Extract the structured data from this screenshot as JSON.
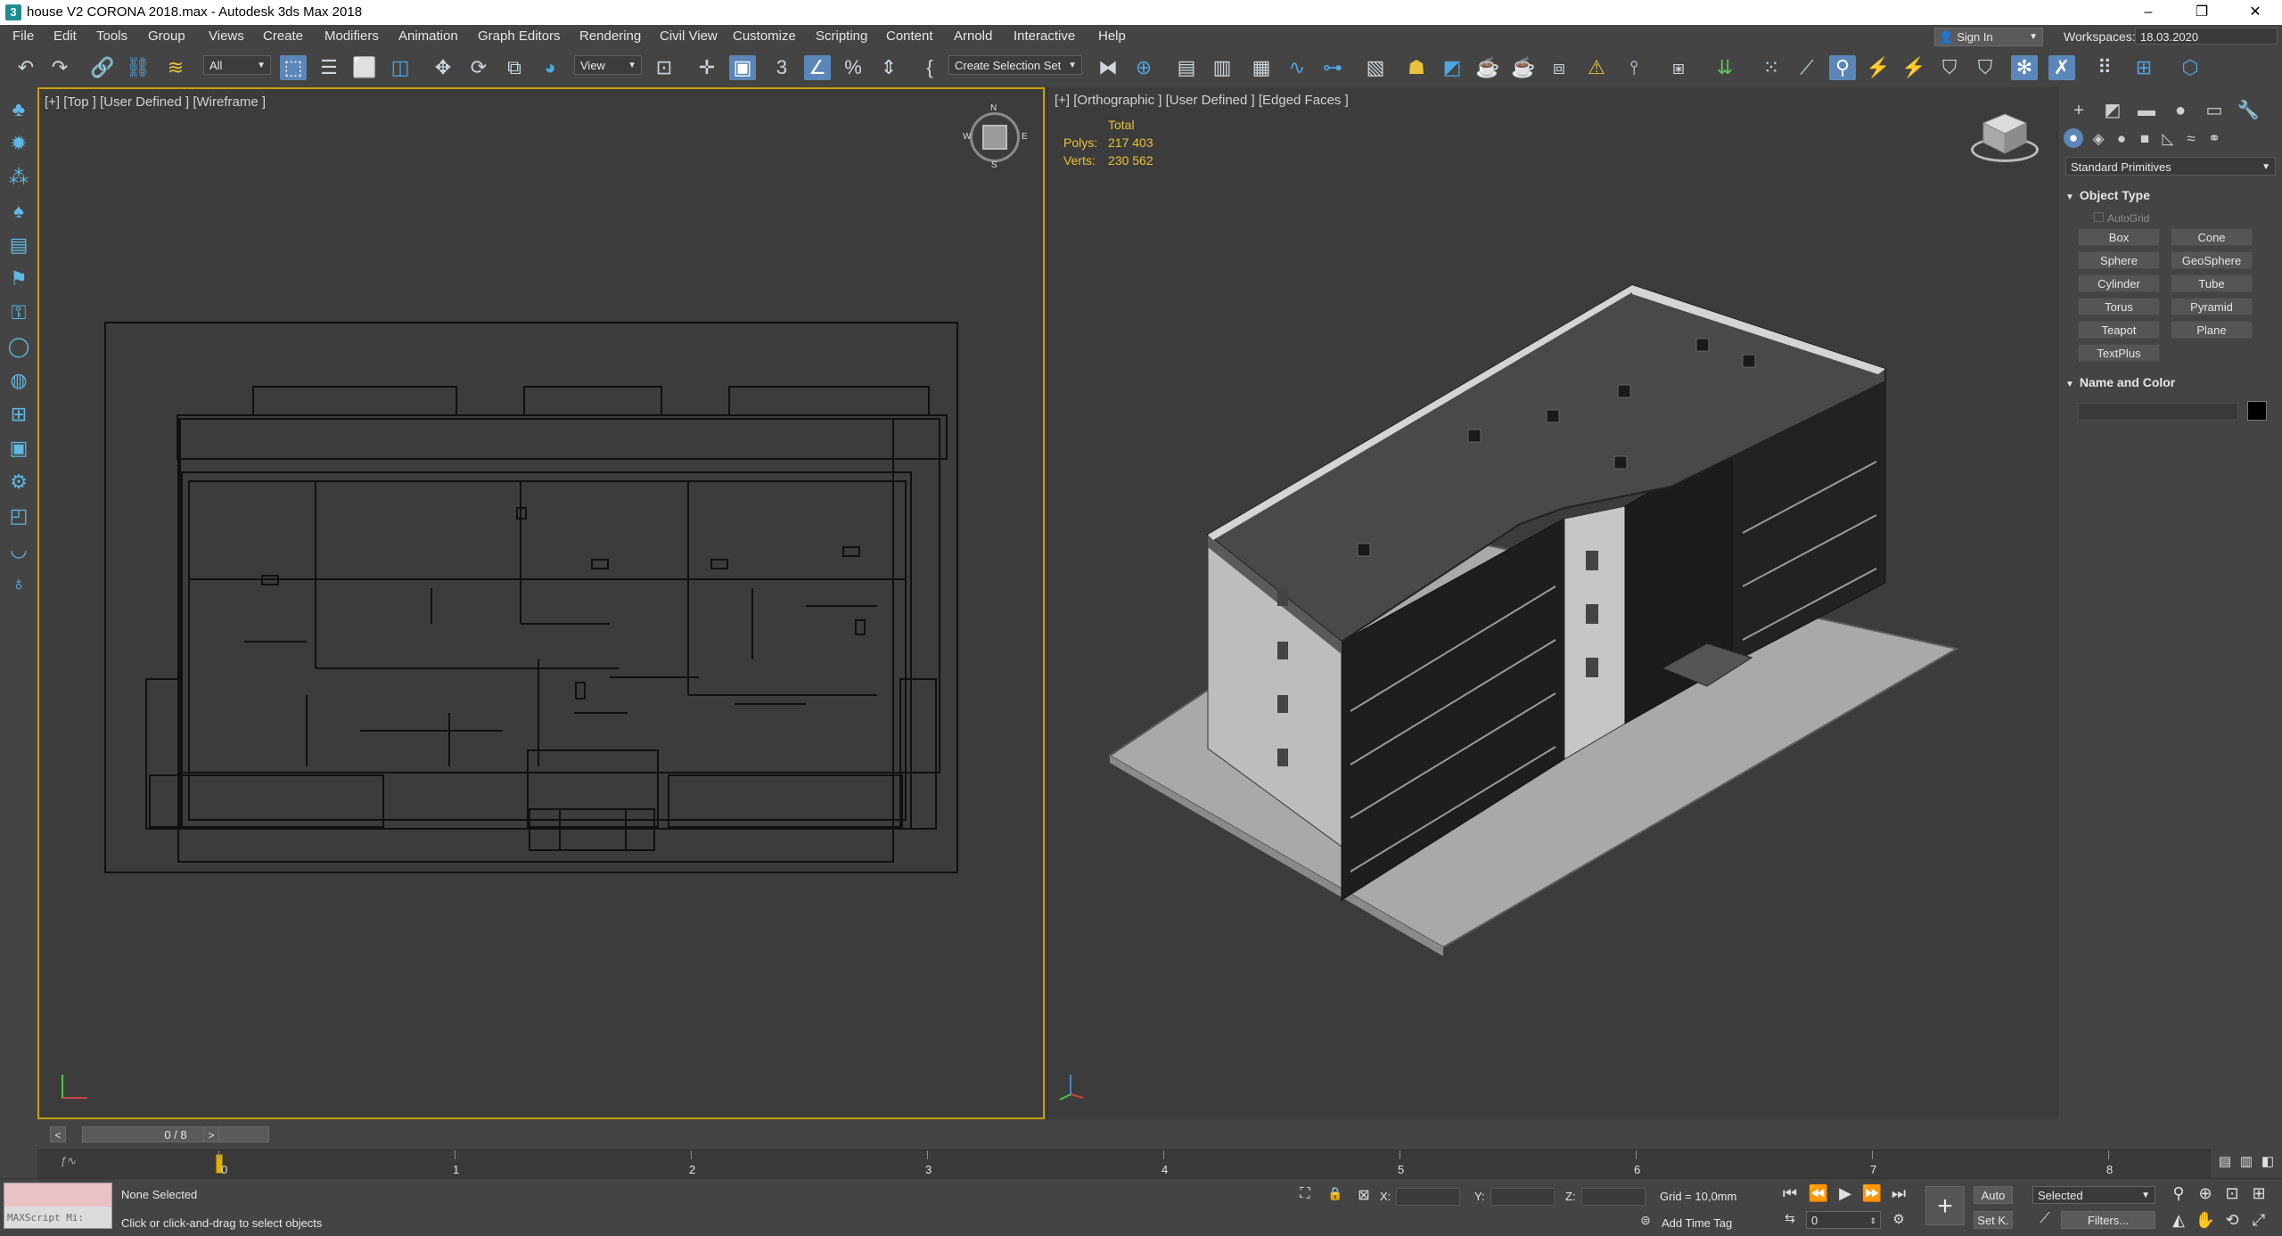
{
  "window": {
    "title": "house V2 CORONA 2018.max - Autodesk 3ds Max 2018",
    "minimize": "–",
    "restore": "❐",
    "close": "✕"
  },
  "menu": {
    "items": [
      "File",
      "Edit",
      "Tools",
      "Group",
      "Views",
      "Create",
      "Modifiers",
      "Animation",
      "Graph Editors",
      "Rendering",
      "Civil View",
      "Customize",
      "Scripting",
      "Content",
      "Arnold",
      "Interactive",
      "Help"
    ],
    "sign_in": "Sign In",
    "workspaces_label": "Workspaces:",
    "workspaces_value": "18.03.2020"
  },
  "toolbar": {
    "selection_filter": "All",
    "reference_coord": "View",
    "selection_set": "Create Selection Set"
  },
  "viewport_top": {
    "label": "[+] [Top ] [User Defined ] [Wireframe ]",
    "compass": {
      "n": "N",
      "s": "S",
      "w": "W",
      "e": "E"
    }
  },
  "viewport_ortho": {
    "label": "[+] [Orthographic ] [User Defined ] [Edged Faces ]",
    "stats": {
      "header": "Total",
      "polys_label": "Polys:",
      "polys_value": "217 403",
      "verts_label": "Verts:",
      "verts_value": "230 562"
    }
  },
  "command_panel": {
    "category": "Standard Primitives",
    "object_type_title": "Object Type",
    "autogrid": "AutoGrid",
    "buttons": [
      "Box",
      "Cone",
      "Sphere",
      "GeoSphere",
      "Cylinder",
      "Tube",
      "Torus",
      "Pyramid",
      "Teapot",
      "Plane",
      "TextPlus"
    ],
    "name_color_title": "Name and Color",
    "color": "#000000"
  },
  "time_slider": {
    "frame": "0 / 8",
    "prev": "<",
    "next": ">"
  },
  "trackbar": {
    "ticks": [
      "0",
      "1",
      "2",
      "3",
      "4",
      "5",
      "6",
      "7",
      "8"
    ]
  },
  "status": {
    "maxscript_label": "MAXScript Mi:",
    "selection": "None Selected",
    "prompt": "Click or click-and-drag to select objects",
    "x_label": "X:",
    "y_label": "Y:",
    "z_label": "Z:",
    "grid": "Grid = 10,0mm",
    "add_time_tag": "Add Time Tag",
    "auto_key": "Auto",
    "set_key": "Set K.",
    "selected": "Selected",
    "filters": "Filters...",
    "frame_value": "0"
  }
}
